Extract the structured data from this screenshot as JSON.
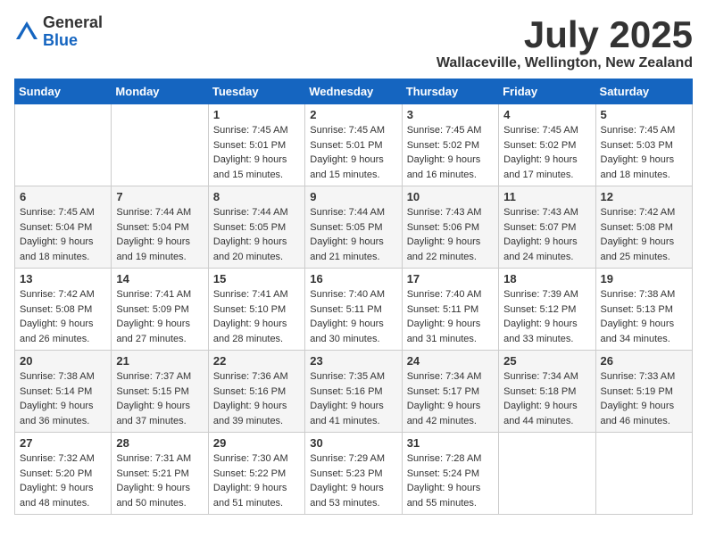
{
  "header": {
    "logo_general": "General",
    "logo_blue": "Blue",
    "month_title": "July 2025",
    "location": "Wallaceville, Wellington, New Zealand"
  },
  "weekdays": [
    "Sunday",
    "Monday",
    "Tuesday",
    "Wednesday",
    "Thursday",
    "Friday",
    "Saturday"
  ],
  "weeks": [
    [
      {
        "day": "",
        "info": ""
      },
      {
        "day": "",
        "info": ""
      },
      {
        "day": "1",
        "info": "Sunrise: 7:45 AM\nSunset: 5:01 PM\nDaylight: 9 hours\nand 15 minutes."
      },
      {
        "day": "2",
        "info": "Sunrise: 7:45 AM\nSunset: 5:01 PM\nDaylight: 9 hours\nand 15 minutes."
      },
      {
        "day": "3",
        "info": "Sunrise: 7:45 AM\nSunset: 5:02 PM\nDaylight: 9 hours\nand 16 minutes."
      },
      {
        "day": "4",
        "info": "Sunrise: 7:45 AM\nSunset: 5:02 PM\nDaylight: 9 hours\nand 17 minutes."
      },
      {
        "day": "5",
        "info": "Sunrise: 7:45 AM\nSunset: 5:03 PM\nDaylight: 9 hours\nand 18 minutes."
      }
    ],
    [
      {
        "day": "6",
        "info": "Sunrise: 7:45 AM\nSunset: 5:04 PM\nDaylight: 9 hours\nand 18 minutes."
      },
      {
        "day": "7",
        "info": "Sunrise: 7:44 AM\nSunset: 5:04 PM\nDaylight: 9 hours\nand 19 minutes."
      },
      {
        "day": "8",
        "info": "Sunrise: 7:44 AM\nSunset: 5:05 PM\nDaylight: 9 hours\nand 20 minutes."
      },
      {
        "day": "9",
        "info": "Sunrise: 7:44 AM\nSunset: 5:05 PM\nDaylight: 9 hours\nand 21 minutes."
      },
      {
        "day": "10",
        "info": "Sunrise: 7:43 AM\nSunset: 5:06 PM\nDaylight: 9 hours\nand 22 minutes."
      },
      {
        "day": "11",
        "info": "Sunrise: 7:43 AM\nSunset: 5:07 PM\nDaylight: 9 hours\nand 24 minutes."
      },
      {
        "day": "12",
        "info": "Sunrise: 7:42 AM\nSunset: 5:08 PM\nDaylight: 9 hours\nand 25 minutes."
      }
    ],
    [
      {
        "day": "13",
        "info": "Sunrise: 7:42 AM\nSunset: 5:08 PM\nDaylight: 9 hours\nand 26 minutes."
      },
      {
        "day": "14",
        "info": "Sunrise: 7:41 AM\nSunset: 5:09 PM\nDaylight: 9 hours\nand 27 minutes."
      },
      {
        "day": "15",
        "info": "Sunrise: 7:41 AM\nSunset: 5:10 PM\nDaylight: 9 hours\nand 28 minutes."
      },
      {
        "day": "16",
        "info": "Sunrise: 7:40 AM\nSunset: 5:11 PM\nDaylight: 9 hours\nand 30 minutes."
      },
      {
        "day": "17",
        "info": "Sunrise: 7:40 AM\nSunset: 5:11 PM\nDaylight: 9 hours\nand 31 minutes."
      },
      {
        "day": "18",
        "info": "Sunrise: 7:39 AM\nSunset: 5:12 PM\nDaylight: 9 hours\nand 33 minutes."
      },
      {
        "day": "19",
        "info": "Sunrise: 7:38 AM\nSunset: 5:13 PM\nDaylight: 9 hours\nand 34 minutes."
      }
    ],
    [
      {
        "day": "20",
        "info": "Sunrise: 7:38 AM\nSunset: 5:14 PM\nDaylight: 9 hours\nand 36 minutes."
      },
      {
        "day": "21",
        "info": "Sunrise: 7:37 AM\nSunset: 5:15 PM\nDaylight: 9 hours\nand 37 minutes."
      },
      {
        "day": "22",
        "info": "Sunrise: 7:36 AM\nSunset: 5:16 PM\nDaylight: 9 hours\nand 39 minutes."
      },
      {
        "day": "23",
        "info": "Sunrise: 7:35 AM\nSunset: 5:16 PM\nDaylight: 9 hours\nand 41 minutes."
      },
      {
        "day": "24",
        "info": "Sunrise: 7:34 AM\nSunset: 5:17 PM\nDaylight: 9 hours\nand 42 minutes."
      },
      {
        "day": "25",
        "info": "Sunrise: 7:34 AM\nSunset: 5:18 PM\nDaylight: 9 hours\nand 44 minutes."
      },
      {
        "day": "26",
        "info": "Sunrise: 7:33 AM\nSunset: 5:19 PM\nDaylight: 9 hours\nand 46 minutes."
      }
    ],
    [
      {
        "day": "27",
        "info": "Sunrise: 7:32 AM\nSunset: 5:20 PM\nDaylight: 9 hours\nand 48 minutes."
      },
      {
        "day": "28",
        "info": "Sunrise: 7:31 AM\nSunset: 5:21 PM\nDaylight: 9 hours\nand 50 minutes."
      },
      {
        "day": "29",
        "info": "Sunrise: 7:30 AM\nSunset: 5:22 PM\nDaylight: 9 hours\nand 51 minutes."
      },
      {
        "day": "30",
        "info": "Sunrise: 7:29 AM\nSunset: 5:23 PM\nDaylight: 9 hours\nand 53 minutes."
      },
      {
        "day": "31",
        "info": "Sunrise: 7:28 AM\nSunset: 5:24 PM\nDaylight: 9 hours\nand 55 minutes."
      },
      {
        "day": "",
        "info": ""
      },
      {
        "day": "",
        "info": ""
      }
    ]
  ]
}
